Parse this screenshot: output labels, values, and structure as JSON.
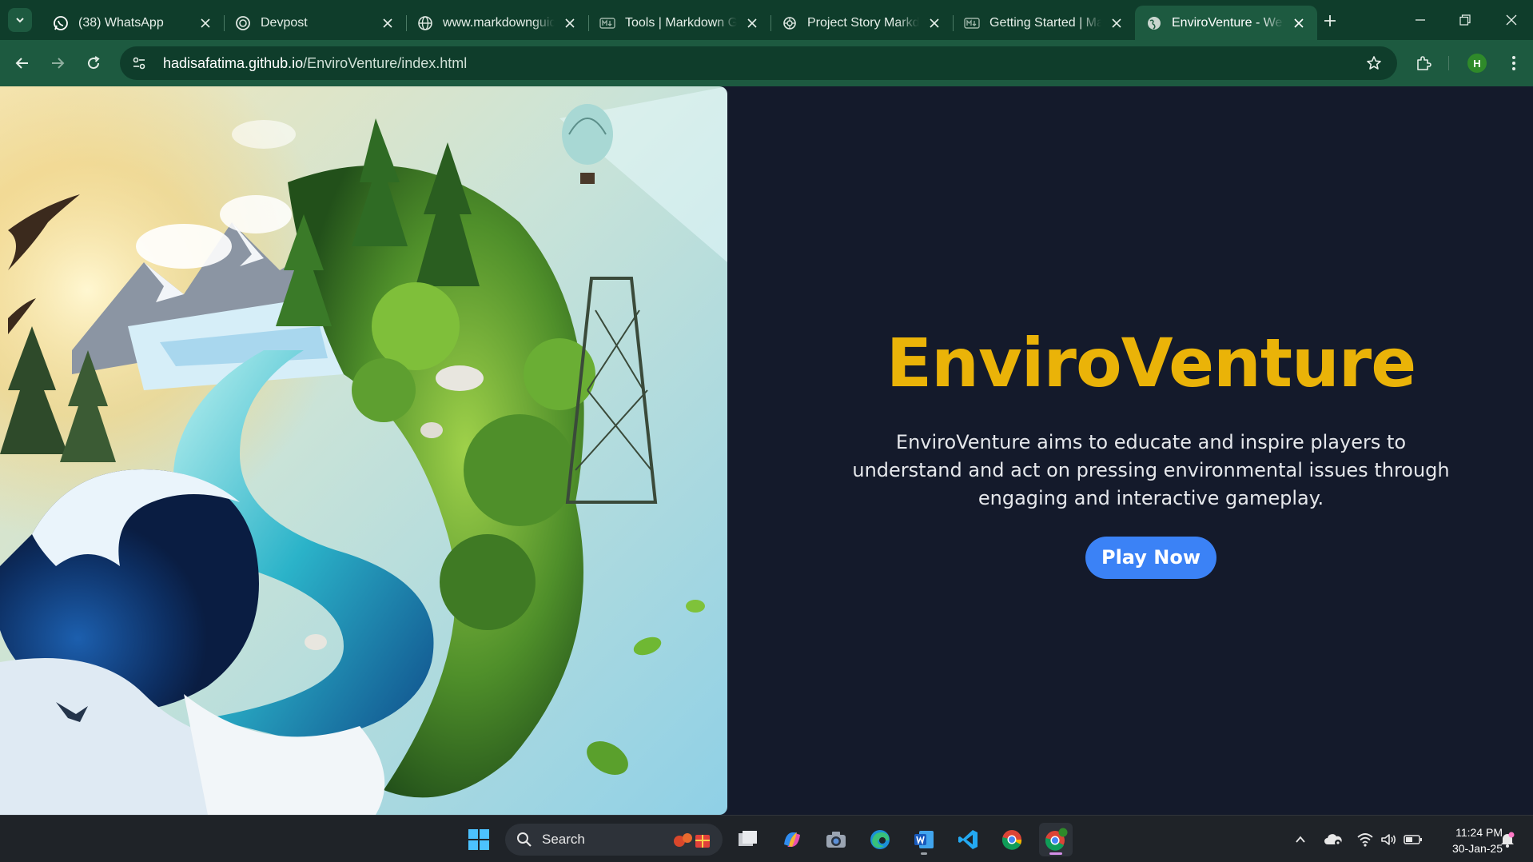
{
  "browser": {
    "tabs": [
      {
        "title": "(38) WhatsApp",
        "icon": "whatsapp-icon",
        "active": false
      },
      {
        "title": "Devpost",
        "icon": "devpost-icon",
        "active": false
      },
      {
        "title": "www.markdownguide.org",
        "icon": "globe-icon",
        "active": false
      },
      {
        "title": "Tools | Markdown Guide",
        "icon": "markdown-icon",
        "active": false
      },
      {
        "title": "Project Story Markdown",
        "icon": "openai-icon",
        "active": false
      },
      {
        "title": "Getting Started | Markdown",
        "icon": "markdown-icon",
        "active": false
      },
      {
        "title": "EnviroVenture - Welcome",
        "icon": "globe-icon",
        "active": true
      }
    ],
    "url": {
      "host": "hadisafatima.github.io",
      "path": "/EnviroVenture/index.html"
    },
    "profile_initial": "H",
    "theme": {
      "frame": "#0f3d2b",
      "toolbar": "#1d5a40"
    }
  },
  "page": {
    "title": "EnviroVenture",
    "description": "EnviroVenture aims to educate and inspire players to understand and act on pressing environmental issues through engaging and interactive gameplay.",
    "cta_label": "Play Now",
    "colors": {
      "background": "#141a2b",
      "title": "#eab308",
      "button": "#3b82f6"
    }
  },
  "taskbar": {
    "search_label": "Search",
    "clock": {
      "time": "11:24 PM",
      "date": "30-Jan-25"
    },
    "pinned": [
      "windows-start-icon",
      "file-explorer-icon",
      "copilot-icon",
      "camera-icon",
      "edge-icon",
      "word-icon",
      "vscode-icon",
      "chrome-icon",
      "chrome-profile-icon"
    ]
  }
}
